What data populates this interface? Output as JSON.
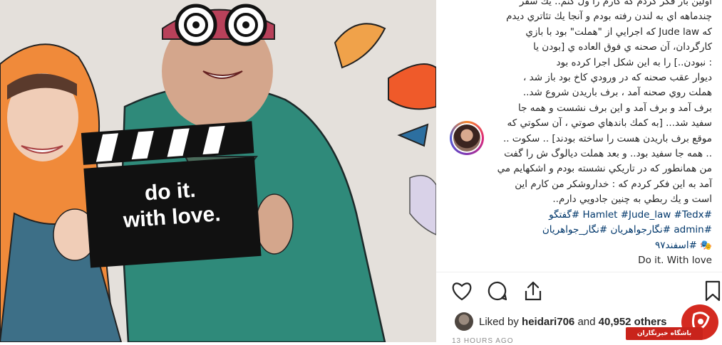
{
  "post": {
    "caption_lines": [
      "اولين بار فكر كردم كه كارم را ول كنم.. يك سفر",
      "چندماهه اي به لندن رفته بودم و آنجا يك تئاتري ديدم",
      "كه Jude law كه اجرايي از \"هملت\" بود با بازي",
      "كارگردان، آن صحنه ي فوق العاده ي [بودن يا",
      ": نبودن..] را به اين شكل اجرا كرده بود",
      "ديوار عقب صحنه كه در ورودي كاخ بود باز شد ،",
      "هملت روي صحنه آمد ، برف باريدن شروع شد..",
      "برف آمد و برف آمد و اين برف نشست و همه جا",
      "سفيد شد... [به كمك باندهاي صوتي ، آن سكوتي كه",
      "موقع برف باريدن هست را ساخته بودند] .. سكوت ..",
      ".. همه جا سفيد بود.. و بعد هملت ديالوگ ش را گفت",
      "من همانطور كه در تاريكي نشسته بودم و اشكهايم مي",
      "آمد به اين فكر كردم كه : خداروشكر من كارم اين",
      "است و يك ربطي به چنين جادويي دارم.."
    ],
    "hashtags_line1": "#Hamlet #Jude_law #Tedx #گفتگو",
    "hashtags_line2": "#admin #نگارجواهریان #نگار_جواهریان",
    "hashtags_line3": "🎭 #اسفند۹۷",
    "signature": "Do it. With love"
  },
  "photo": {
    "slate_text_line1": "do it.",
    "slate_text_line2": "with love."
  },
  "likes": {
    "prefix": "Liked by",
    "user": "heidari706",
    "connector": "and",
    "count": "40,952 others"
  },
  "timestamp": "13 HOURS AGO",
  "watermark": {
    "text": "باشگاه خبرنگاران"
  },
  "colors": {
    "text": "#262626",
    "hashtag": "#00376b",
    "muted": "#8e8e8e",
    "watermark_red": "#d42a20"
  },
  "icons": [
    "heart-icon",
    "comment-icon",
    "share-icon",
    "bookmark-icon"
  ]
}
